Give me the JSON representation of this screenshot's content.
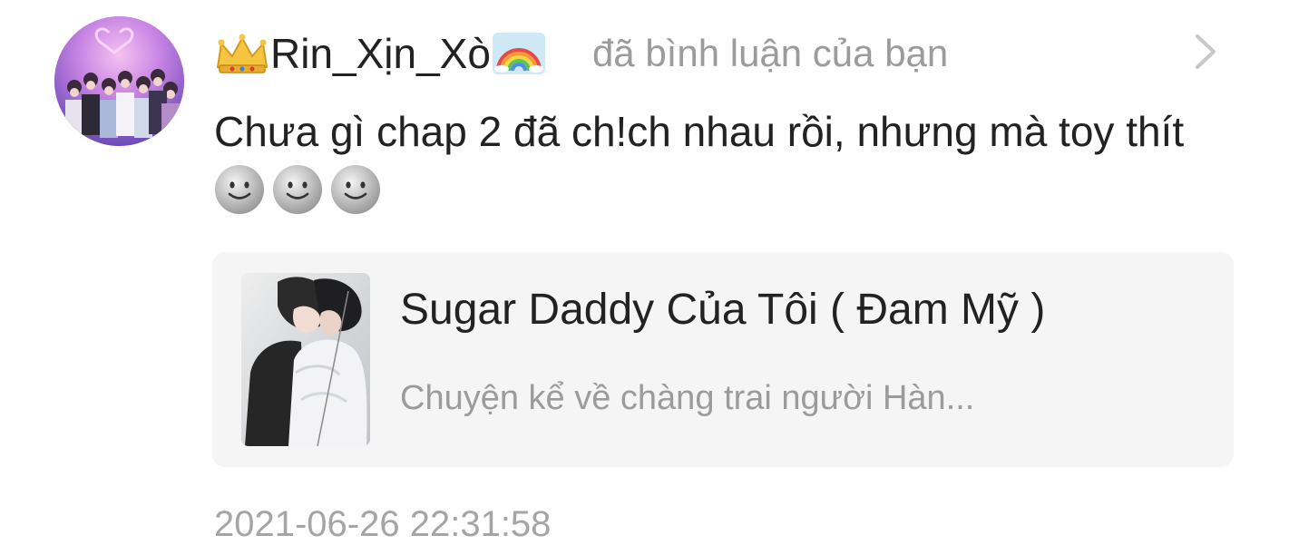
{
  "notification": {
    "username": "Rin_Xịn_Xò",
    "username_prefix_icon": "crown-icon",
    "username_suffix_icon": "rainbow-icon",
    "action_text": "đã bình luận của bạn",
    "comment": "Chưa gì chap 2 đã ch!ch nhau rồi, nhưng mà toy thít",
    "comment_emojis": [
      "slightly-smiling-face-icon",
      "slightly-smiling-face-icon",
      "slightly-smiling-face-icon"
    ],
    "timestamp": "2021-06-26 22:31:58"
  },
  "story": {
    "title": "Sugar Daddy Của Tôi ( Đam Mỹ )",
    "description": "Chuyện kể về chàng trai người Hàn..."
  },
  "colors": {
    "primary_text": "#222222",
    "secondary_text": "#9b9b9b",
    "card_background": "#f5f5f5",
    "background": "#ffffff"
  }
}
